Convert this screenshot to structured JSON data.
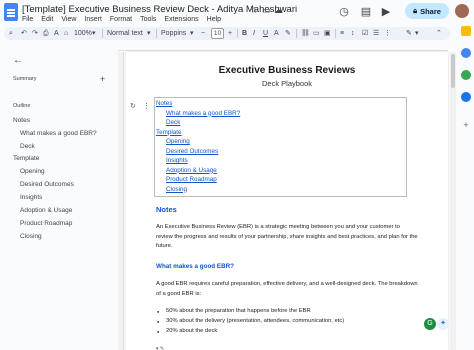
{
  "window": {
    "title": "[Template] Executive Business Review Deck - Aditya Maheshwari",
    "menu": [
      "File",
      "Edit",
      "View",
      "Insert",
      "Format",
      "Tools",
      "Extensions",
      "Help"
    ],
    "share_label": "Share"
  },
  "toolbar": {
    "zoom": "100%",
    "style": "Normal text",
    "font": "Poppins",
    "font_size": "10"
  },
  "sidebar": {
    "summary_label": "Summary",
    "summary_add": "+",
    "outline_label": "Outline",
    "items": [
      {
        "label": "Notes",
        "level": 1
      },
      {
        "label": "What makes a good EBR?",
        "level": 2
      },
      {
        "label": "Deck",
        "level": 2
      },
      {
        "label": "Template",
        "level": 1
      },
      {
        "label": "Opening",
        "level": 2
      },
      {
        "label": "Desired Outcomes",
        "level": 2
      },
      {
        "label": "Insights",
        "level": 2
      },
      {
        "label": "Adoption & Usage",
        "level": 2
      },
      {
        "label": "Product Roadmap",
        "level": 2
      },
      {
        "label": "Closing",
        "level": 2
      }
    ]
  },
  "document": {
    "title": "Executive Business Reviews",
    "subtitle": "Deck Playbook",
    "toc": [
      {
        "label": "Notes",
        "level": 1
      },
      {
        "label": "What makes a good EBR?",
        "level": 2
      },
      {
        "label": "Deck",
        "level": 2
      },
      {
        "label": "Template",
        "level": 1
      },
      {
        "label": "Opening",
        "level": 2
      },
      {
        "label": "Desired Outcomes",
        "level": 2
      },
      {
        "label": "Insights",
        "level": 2
      },
      {
        "label": "Adoption & Usage",
        "level": 2
      },
      {
        "label": "Product Roadmap",
        "level": 2
      },
      {
        "label": "Closing",
        "level": 2
      }
    ],
    "notes_heading": "Notes",
    "notes_para_1": "An Executive Business Review (EBR) is a strategic meeting between you and your customer to review the progress and results of your partnership, share insights and best practices, and plan for the future.",
    "ebr_heading": "What makes a good EBR?",
    "ebr_para": "A good EBR requires careful preparation, effective delivery, and a well-designed deck. The breakdown of a good EBR is:",
    "bullets": [
      "50% about the preparation that happens before the EBR",
      "30% about the delivery (presentation, attendees, communication, etc)",
      "20% about the deck"
    ]
  }
}
